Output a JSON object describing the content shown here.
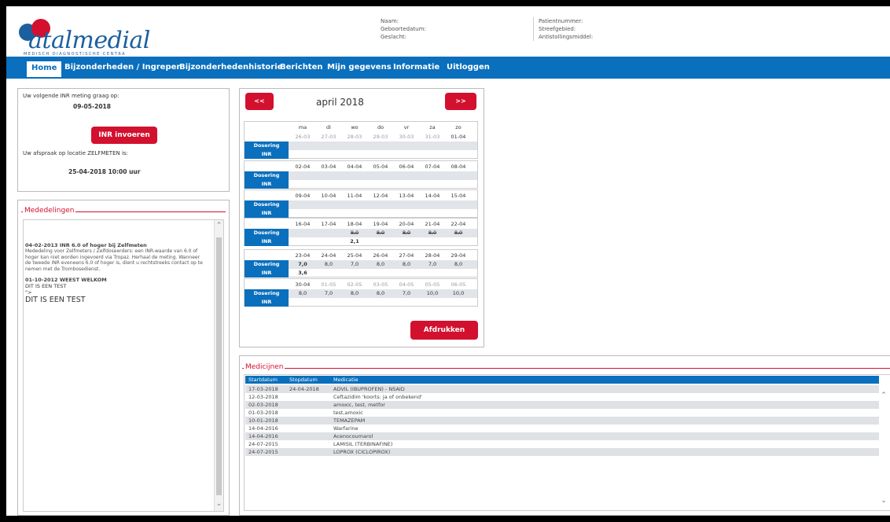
{
  "header": {
    "logo_text": "atalmedial",
    "logo_sub": "MEDISCH DIAGNOSTISCHE CENTRA",
    "labels_left": [
      "Naam:",
      "Geboortedatum:",
      "Geslacht:"
    ],
    "labels_right": [
      "Patientnummer:",
      "Streefgebied:",
      "Antistollingsmiddel:"
    ]
  },
  "nav": {
    "items": [
      "Home",
      "Bijzonderheden / Ingrepen",
      "Bijzonderhedenhistorie",
      "Berichten",
      "Mijn gegevens",
      "Informatie",
      "Uitloggen"
    ]
  },
  "inr_panel": {
    "next_label": "Uw volgende INR meting graag op:",
    "next_date": "09-05-2018",
    "button": "INR invoeren",
    "appointment_label": "Uw afspraak op locatie ZELFMETEN is:",
    "appointment_date": "25-04-2018 10:00 uur"
  },
  "mededelingen": {
    "legend": "Mededelingen",
    "title1": "04-02-2013 INR 6.0 of hoger bij Zelfmeten",
    "body1": "Mededeling voor Zelfmeters / Zelfdoseerders: een INR-waarde van 6.0 of hoger kan niet worden ingevoerd via Tropaz. Herhaal de meting. Wanneer de tweede INR eveneens 6.0 of hoger is, dient u rechtstreeks contact op te nemen met de Trombosedienst.",
    "title2": "01-10-2012 WEEST WELKOM",
    "line2a": "DIT IS EEN TEST",
    "line2b": "\">",
    "line2c": "DIT IS EEN TEST"
  },
  "calendar": {
    "prev": "<<",
    "next": ">>",
    "month": "april 2018",
    "day_names": [
      "ma",
      "di",
      "wo",
      "do",
      "vr",
      "za",
      "zo"
    ],
    "label_dosering": "Dosering",
    "label_inr": "INR",
    "print_button": "Afdrukken",
    "weeks": [
      {
        "dates": [
          "26-03",
          "27-03",
          "28-03",
          "29-03",
          "30-03",
          "31-03",
          "01-04"
        ],
        "grey": [
          true,
          true,
          true,
          true,
          true,
          true,
          false
        ],
        "dosering": [
          "",
          "",
          "",
          "",
          "",
          "",
          ""
        ],
        "dosering_style": [],
        "inr": [
          "",
          "",
          "",
          "",
          "",
          "",
          ""
        ]
      },
      {
        "dates": [
          "02-04",
          "03-04",
          "04-04",
          "05-04",
          "06-04",
          "07-04",
          "08-04"
        ],
        "grey": [
          false,
          false,
          false,
          false,
          false,
          false,
          false
        ],
        "dosering": [
          "",
          "",
          "",
          "",
          "",
          "",
          ""
        ],
        "inr": [
          "",
          "",
          "",
          "",
          "",
          "",
          ""
        ]
      },
      {
        "dates": [
          "09-04",
          "10-04",
          "11-04",
          "12-04",
          "13-04",
          "14-04",
          "15-04"
        ],
        "grey": [
          false,
          false,
          false,
          false,
          false,
          false,
          false
        ],
        "dosering": [
          "",
          "",
          "",
          "",
          "",
          "",
          ""
        ],
        "inr": [
          "",
          "",
          "",
          "",
          "",
          "",
          ""
        ]
      },
      {
        "dates": [
          "16-04",
          "17-04",
          "18-04",
          "19-04",
          "20-04",
          "21-04",
          "22-04"
        ],
        "grey": [
          false,
          false,
          false,
          false,
          false,
          false,
          false
        ],
        "dosering": [
          "",
          "",
          "8,0",
          "8,0",
          "8,0",
          "8,0",
          "8,0"
        ],
        "strike": true,
        "inr": [
          "",
          "",
          "2,1",
          "",
          "",
          "",
          ""
        ]
      },
      {
        "dates": [
          "23-04",
          "24-04",
          "25-04",
          "26-04",
          "27-04",
          "28-04",
          "29-04"
        ],
        "grey": [
          false,
          false,
          false,
          false,
          false,
          false,
          false
        ],
        "dosering": [
          "7,0",
          "8,0",
          "7,0",
          "8,0",
          "8,0",
          "7,0",
          "8,0"
        ],
        "first_blue": true,
        "inr": [
          "3,6",
          "",
          "",
          "",
          "",
          "",
          ""
        ]
      },
      {
        "dates": [
          "30-04",
          "01-05",
          "02-05",
          "03-05",
          "04-05",
          "05-05",
          "06-05"
        ],
        "grey": [
          false,
          true,
          true,
          true,
          true,
          true,
          true
        ],
        "dosering": [
          "8,0",
          "7,0",
          "8,0",
          "8,0",
          "7,0",
          "10,0",
          "10,0"
        ],
        "inr": [
          "",
          "",
          "",
          "",
          "",
          "",
          ""
        ]
      }
    ]
  },
  "medicijnen": {
    "legend": "Medicijnen",
    "columns": [
      "Startdatum",
      "Stopdatum",
      "Medicatie"
    ],
    "rows": [
      [
        "17-03-2018",
        "24-04-2018",
        "ADVIL (IBUPROFEN) - NSAID"
      ],
      [
        "12-03-2018",
        "",
        "Ceftazidim 'koorts: ja of onbekend'"
      ],
      [
        "02-03-2018",
        "",
        "amoxic, test, metfor"
      ],
      [
        "01-03-2018",
        "",
        "test,amoxic"
      ],
      [
        "10-01-2018",
        "",
        "TEMAZEPAM"
      ],
      [
        "14-04-2016",
        "",
        "Warfarine"
      ],
      [
        "14-04-2016",
        "",
        "Acenocoumarol"
      ],
      [
        "24-07-2015",
        "",
        "LAMISIL (TERBINAFINE)"
      ],
      [
        "24-07-2015",
        "",
        "LOPROX (CICLOPIROX)"
      ]
    ]
  },
  "colors": {
    "brand_blue": "#0a6fbc",
    "brand_red": "#d3102e"
  },
  "icons": {
    "scroll_up": "chevron-up-icon",
    "scroll_down": "chevron-down-icon"
  }
}
